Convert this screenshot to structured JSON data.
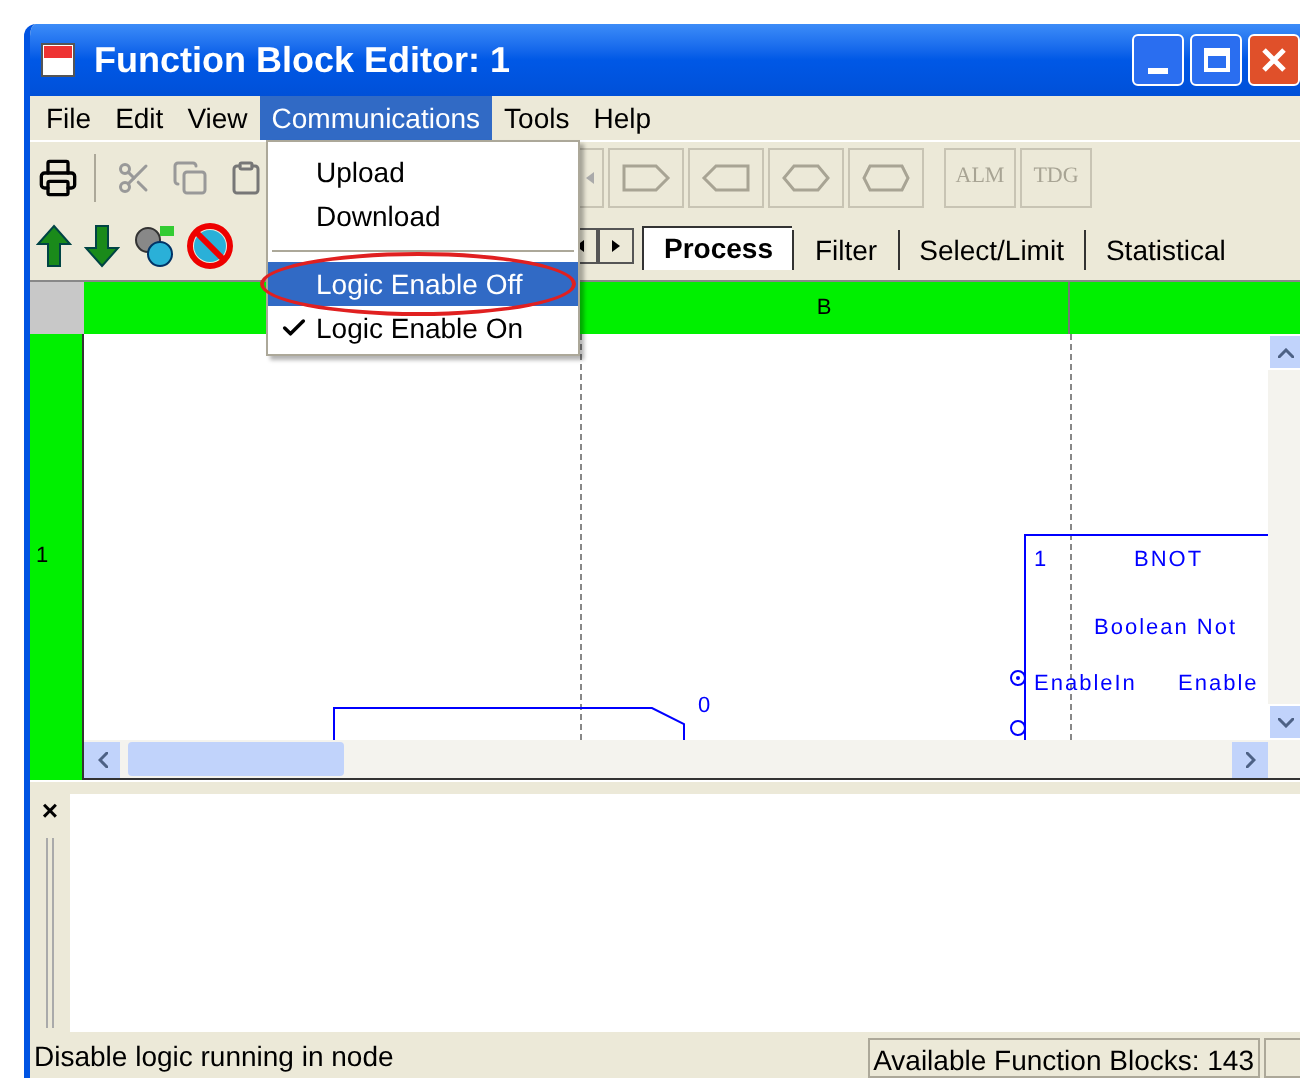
{
  "window": {
    "title": "Function Block Editor: 1"
  },
  "menu_bar": [
    {
      "label": "File",
      "selected": false
    },
    {
      "label": "Edit",
      "selected": false
    },
    {
      "label": "View",
      "selected": false
    },
    {
      "label": "Communications",
      "selected": true
    },
    {
      "label": "Tools",
      "selected": false
    },
    {
      "label": "Help",
      "selected": false
    }
  ],
  "open_menu": {
    "items": [
      {
        "kind": "item",
        "label": "Upload",
        "highlighted": false,
        "checked": false,
        "circled": false
      },
      {
        "kind": "item",
        "label": "Download",
        "highlighted": false,
        "checked": false,
        "circled": false
      },
      {
        "kind": "separator"
      },
      {
        "kind": "item",
        "label": "Logic Enable Off",
        "highlighted": true,
        "checked": false,
        "circled": true
      },
      {
        "kind": "item",
        "label": "Logic Enable On",
        "highlighted": false,
        "checked": true,
        "circled": false
      }
    ]
  },
  "toolbar": {
    "text_buttons": [
      {
        "label": "ALM",
        "disabled": true
      },
      {
        "label": "TDG",
        "disabled": true
      }
    ]
  },
  "tabs": [
    {
      "label": "Process",
      "selected": true
    },
    {
      "label": "Filter",
      "selected": false
    },
    {
      "label": "Select/Limit",
      "selected": false
    },
    {
      "label": "Statistical",
      "selected": false
    }
  ],
  "grid": {
    "column_header": "B",
    "row_header": "1"
  },
  "blocks": [
    {
      "number": "1",
      "name": "BNOT",
      "description": "Boolean Not",
      "input": "EnableIn",
      "output": "Enable"
    }
  ],
  "pin_label": "0",
  "output_pane": {
    "close": "×"
  },
  "status_bar": {
    "message": "Disable logic running in node",
    "panel": "Available Function Blocks: 143"
  }
}
